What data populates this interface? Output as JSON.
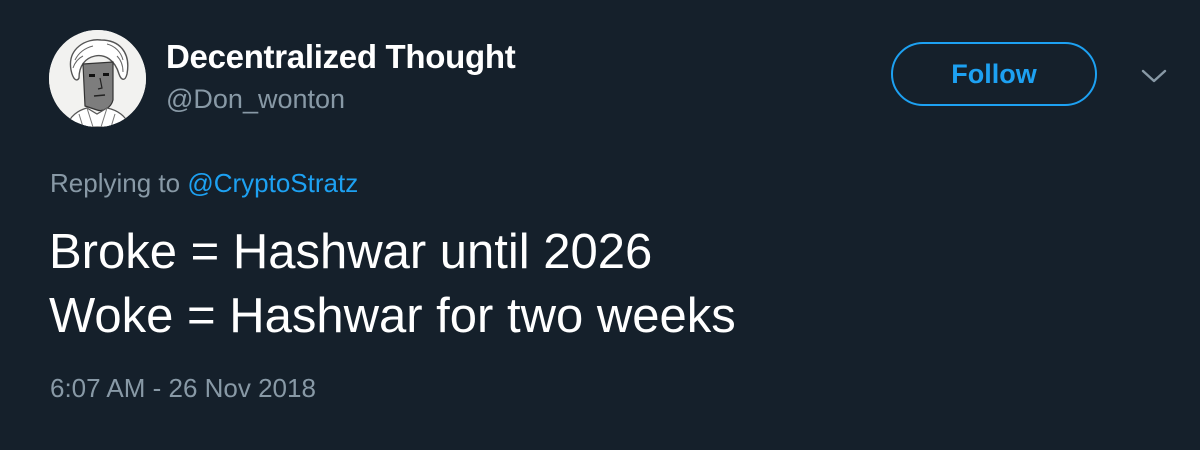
{
  "author": {
    "display_name": "Decentralized Thought",
    "handle": "@Don_wonton",
    "avatar_icon": "sketch-portrait-avatar"
  },
  "actions": {
    "follow_label": "Follow",
    "more_icon": "chevron-down-icon"
  },
  "reply": {
    "prefix": "Replying to ",
    "mention": "@CryptoStratz"
  },
  "tweet": {
    "lines": [
      "Broke = Hashwar until 2026",
      "Woke = Hashwar for two weeks"
    ],
    "timestamp": "6:07 AM - 26 Nov 2018"
  },
  "colors": {
    "background": "#15202b",
    "text_primary": "#ffffff",
    "text_secondary": "#8899a6",
    "accent": "#1da1f2"
  }
}
